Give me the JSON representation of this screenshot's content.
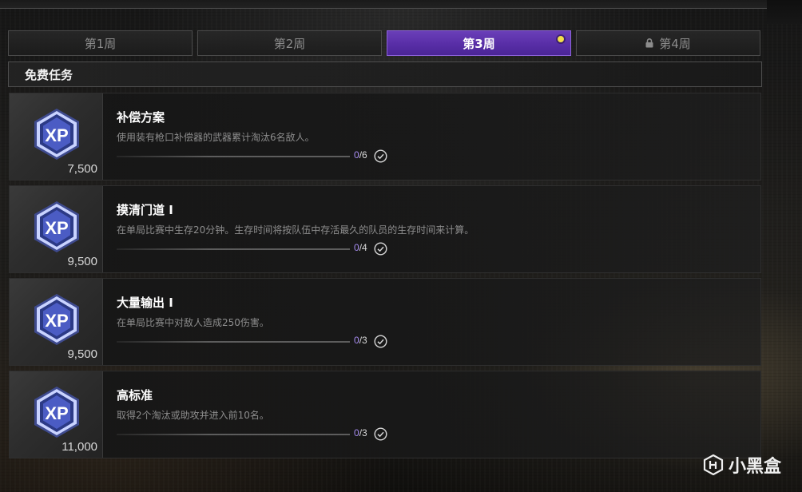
{
  "tabs": [
    {
      "label": "第1周",
      "active": false,
      "locked": false
    },
    {
      "label": "第2周",
      "active": false,
      "locked": false
    },
    {
      "label": "第3周",
      "active": true,
      "locked": false,
      "indicator": true
    },
    {
      "label": "第4周",
      "active": false,
      "locked": true
    }
  ],
  "section": {
    "title": "免费任务"
  },
  "missions": [
    {
      "title": "补偿方案",
      "description": "使用装有枪口补偿器的武器累计淘汰6名敌人。",
      "reward": "7,500",
      "progress_current": "0",
      "progress_total": "/6",
      "progress_fraction": 0
    },
    {
      "title": "摸清门道 I",
      "description": "在单局比赛中生存20分钟。生存时间将按队伍中存活最久的队员的生存时间来计算。",
      "reward": "9,500",
      "progress_current": "0",
      "progress_total": "/4",
      "progress_fraction": 0
    },
    {
      "title": "大量输出 I",
      "description": "在单局比赛中对敌人造成250伤害。",
      "reward": "9,500",
      "progress_current": "0",
      "progress_total": "/3",
      "progress_fraction": 0
    },
    {
      "title": "高标准",
      "description": "取得2个淘汰或助攻并进入前10名。",
      "reward": "11,000",
      "progress_current": "0",
      "progress_total": "/3",
      "progress_fraction": 0
    }
  ],
  "icons": {
    "reward": "xp-badge-icon",
    "claim": "check-circle-icon",
    "lock": "lock-icon"
  },
  "watermark": {
    "text": "小黑盒"
  },
  "colors": {
    "accent_purple": "#5a2fa8",
    "progress_purple": "#a58bef",
    "indicator_yellow": "#f3e04a"
  }
}
